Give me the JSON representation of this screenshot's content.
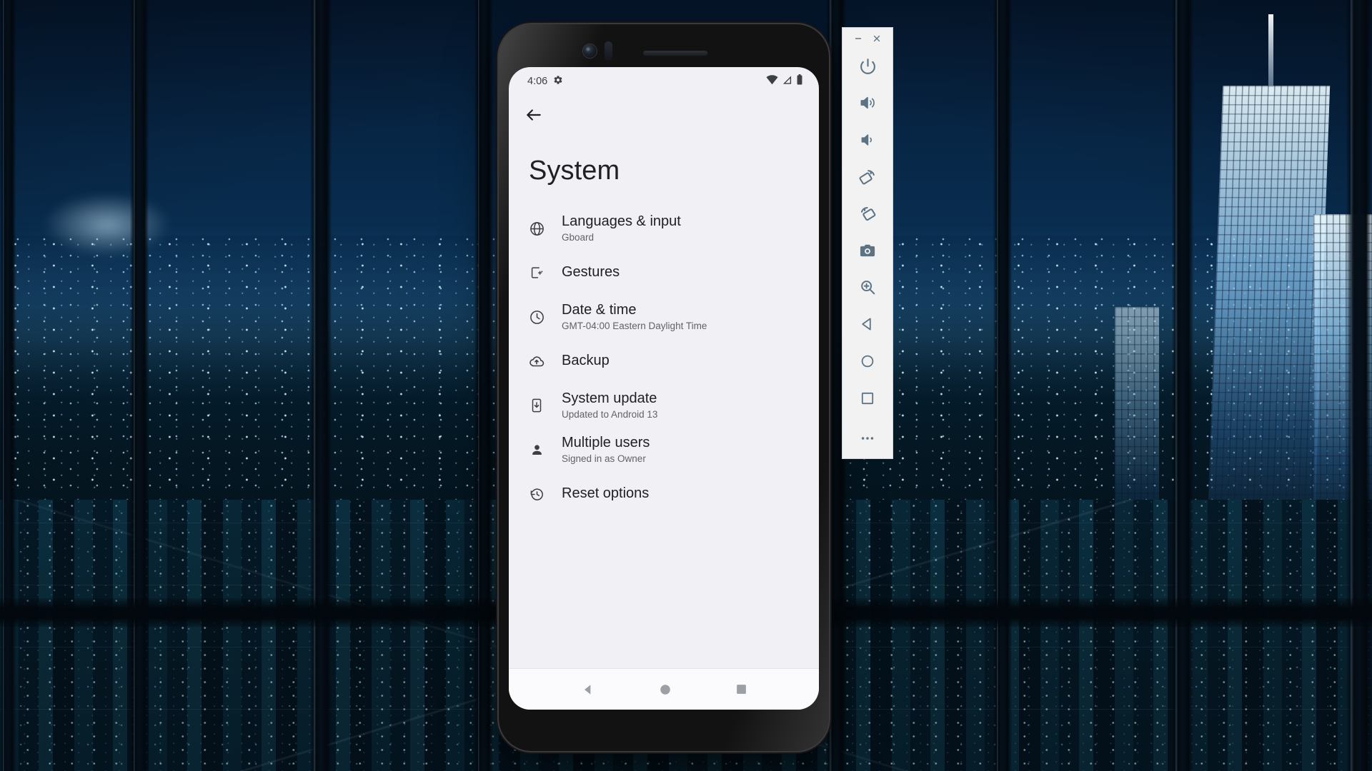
{
  "wallpaper": {
    "description": "night cityscape through tall windows",
    "sky_color": "#072646",
    "city_light_color": "#e1f5ff",
    "mullion_color": "#06101a"
  },
  "phone": {
    "frame_color": "#121212",
    "screen_bg": "#f1f0f4"
  },
  "status_bar": {
    "time": "4:06",
    "settings_icon": "gear-icon",
    "icons": [
      "wifi-icon",
      "cellular-signal-icon",
      "battery-icon"
    ]
  },
  "app_bar": {
    "back_icon": "back-arrow-icon"
  },
  "page": {
    "title": "System"
  },
  "settings_items": [
    {
      "icon": "globe-icon",
      "title": "Languages & input",
      "subtitle": "Gboard"
    },
    {
      "icon": "gestures-phone-icon",
      "title": "Gestures",
      "subtitle": ""
    },
    {
      "icon": "clock-icon",
      "title": "Date & time",
      "subtitle": "GMT-04:00 Eastern Daylight Time"
    },
    {
      "icon": "cloud-upload-icon",
      "title": "Backup",
      "subtitle": ""
    },
    {
      "icon": "system-update-icon",
      "title": "System update",
      "subtitle": "Updated to Android 13"
    },
    {
      "icon": "person-icon",
      "title": "Multiple users",
      "subtitle": "Signed in as Owner"
    },
    {
      "icon": "history-restore-icon",
      "title": "Reset options",
      "subtitle": ""
    }
  ],
  "nav_bar": {
    "buttons": [
      {
        "name": "back-button",
        "icon": "triangle-left-icon"
      },
      {
        "name": "home-button",
        "icon": "circle-icon"
      },
      {
        "name": "recents-button",
        "icon": "square-icon"
      }
    ]
  },
  "emulator_toolbar": {
    "background": "#f2f2f2",
    "icon_color": "#5d7384",
    "window_buttons": [
      {
        "name": "minimize-button",
        "icon": "minimize-icon"
      },
      {
        "name": "close-button",
        "icon": "close-icon"
      }
    ],
    "controls": [
      {
        "name": "power-button",
        "icon": "power-icon"
      },
      {
        "name": "volume-up-button",
        "icon": "volume-up-icon"
      },
      {
        "name": "volume-down-button",
        "icon": "volume-down-icon"
      },
      {
        "name": "rotate-left-button",
        "icon": "rotate-left-icon"
      },
      {
        "name": "rotate-right-button",
        "icon": "rotate-right-icon"
      },
      {
        "name": "screenshot-button",
        "icon": "camera-icon"
      },
      {
        "name": "zoom-button",
        "icon": "magnifier-plus-icon"
      },
      {
        "name": "back-button",
        "icon": "triangle-left-icon"
      },
      {
        "name": "home-button",
        "icon": "circle-icon"
      },
      {
        "name": "overview-button",
        "icon": "square-icon"
      },
      {
        "name": "more-button",
        "icon": "ellipsis-icon"
      }
    ]
  }
}
